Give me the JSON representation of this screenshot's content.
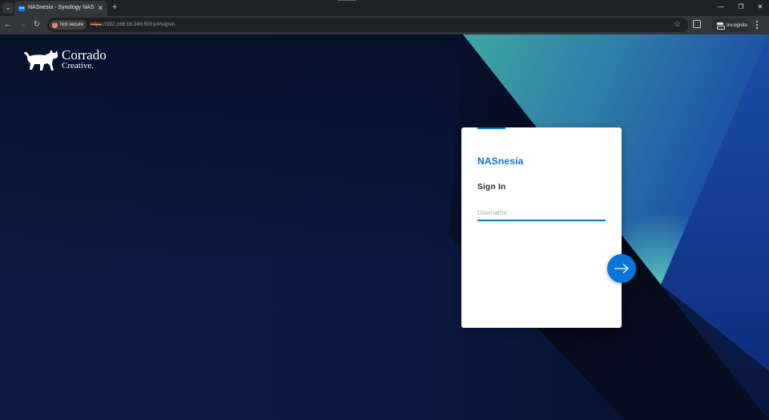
{
  "browser": {
    "tab_title": "NASnesia - Synology NAS",
    "tab_favicon_text": "DSM",
    "security_label": "Not secure",
    "url_scheme": "https",
    "url_rest": "://192.168.18.249:5001/#/signin",
    "incognito_label": "Incognito",
    "icons": {
      "tab_search": "chevron-down-icon",
      "close_tab": "close-icon",
      "new_tab": "plus-icon",
      "back": "arrow-left-icon",
      "forward": "arrow-right-icon",
      "reload": "reload-icon",
      "bookmark": "star-icon",
      "extensions": "puzzle-icon",
      "menu": "kebab-menu-icon",
      "minimize": "minimize-icon",
      "restore": "restore-icon",
      "close_window": "close-icon"
    }
  },
  "page": {
    "logo": {
      "line1": "Corrado",
      "line2": "Creative."
    },
    "login": {
      "brand": "NASnesia",
      "heading": "Sign In",
      "username_placeholder": "Username",
      "username_value": "",
      "submit_icon": "arrow-right-icon"
    },
    "colors": {
      "accent": "#0a74d9",
      "background_navy": "#0a1840",
      "background_teal": "#40a8a2",
      "background_blue": "#1a4fa8"
    }
  }
}
